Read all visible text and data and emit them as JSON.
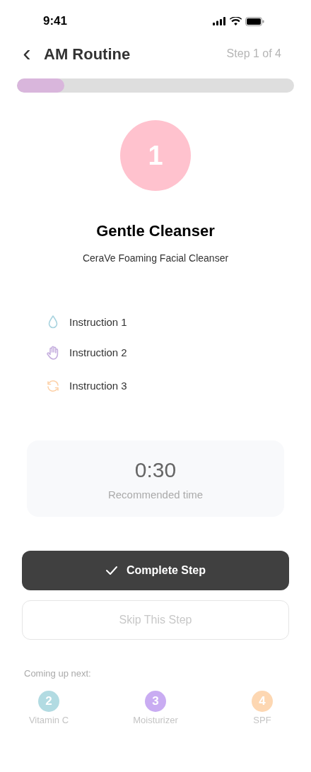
{
  "status_bar": {
    "time": "9:41"
  },
  "header": {
    "back_icon": "‹",
    "title": "AM Routine",
    "step_label": "Step 1 of 4"
  },
  "progress": {
    "level": 0.17
  },
  "step": {
    "number": "1",
    "title": "Gentle Cleanser",
    "product": "CeraVe Foaming Facial Cleanser"
  },
  "instructions": [
    {
      "kind": "drop",
      "color": "#a8d3df",
      "text": "Instruction 1"
    },
    {
      "kind": "hand",
      "color": "#c5aede",
      "text": "Instruction 2"
    },
    {
      "kind": "refresh",
      "color": "#fdd1a8",
      "text": "Instruction 3"
    }
  ],
  "timer": {
    "time": "0:30",
    "label": "Recommended time"
  },
  "buttons": {
    "complete": "Complete Step",
    "skip": "Skip This Step"
  },
  "upcoming": {
    "title": "Coming up next:",
    "items": [
      {
        "number": "2",
        "label": "Vitamin C",
        "color": "#b2dbe2"
      },
      {
        "number": "3",
        "label": "Moisturizer",
        "color": "#c9acf2"
      },
      {
        "number": "4",
        "label": "SPF",
        "color": "#fdd7b2"
      }
    ]
  }
}
